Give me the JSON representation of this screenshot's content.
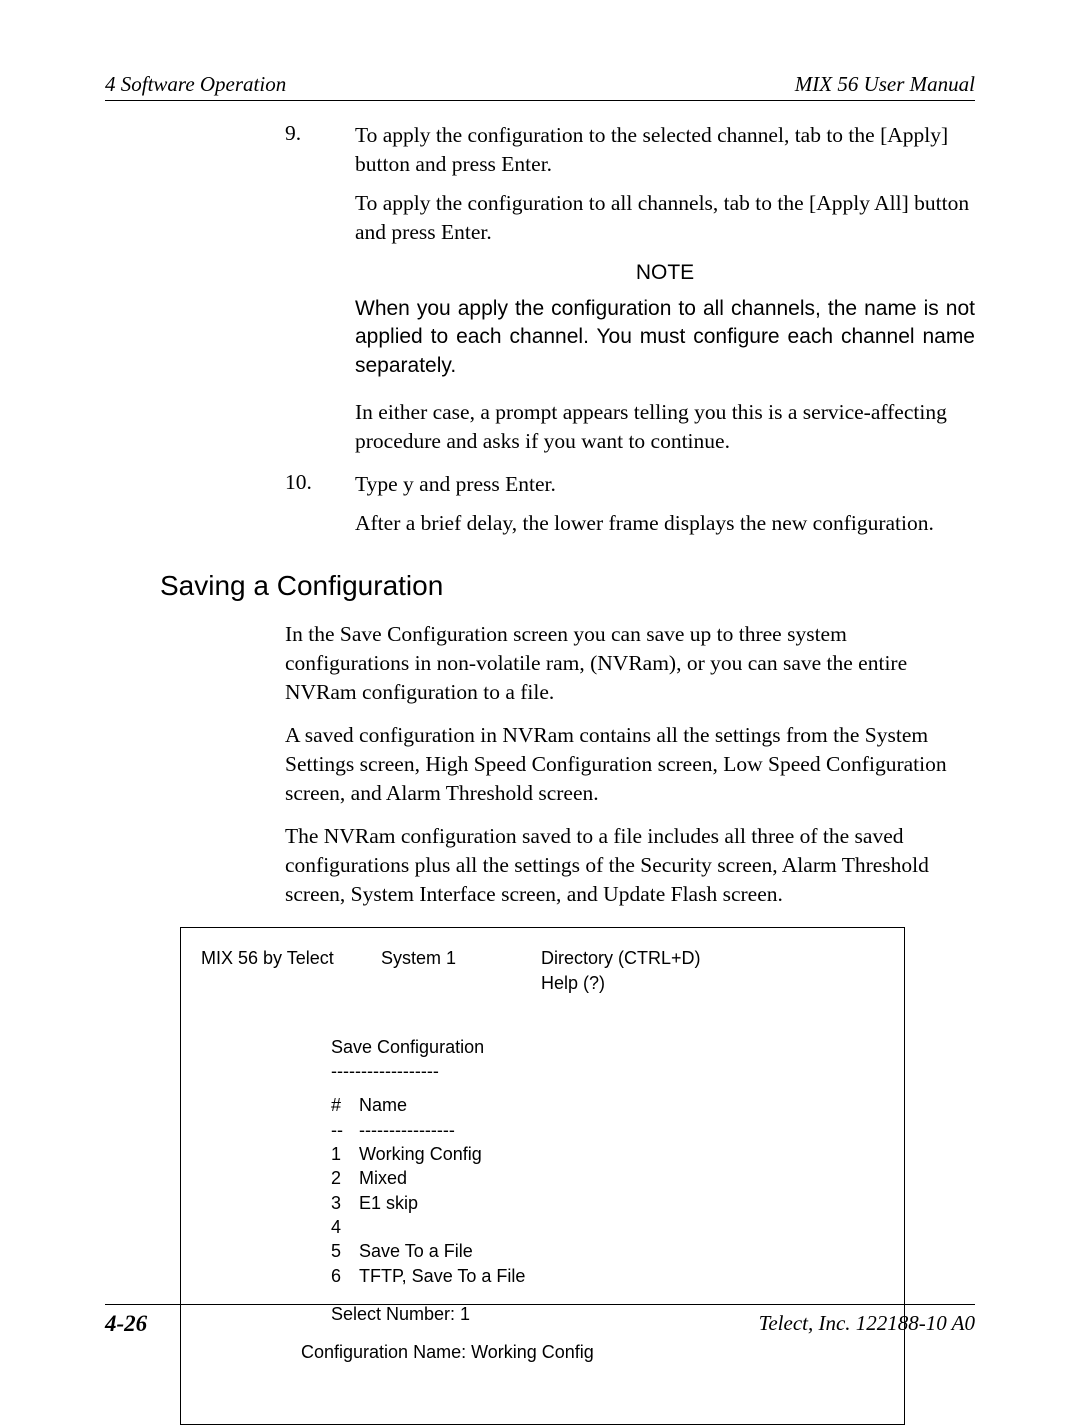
{
  "header": {
    "left": "4  Software Operation",
    "right": "MIX 56 User Manual"
  },
  "steps": {
    "s9num": "9.",
    "s9text": "To apply the configuration to the selected channel, tab to the [Apply] button and press Enter.",
    "s9follow": "To apply the configuration to all channels, tab to the [Apply All] button and press Enter.",
    "noteLabel": "NOTE",
    "noteBody": "When you apply the configuration to all channels, the name is not applied to each channel. You must configure each channel name separately.",
    "s9follow2": "In either case, a prompt appears telling you this is a service-affecting procedure and asks if you want to continue.",
    "s10num": "10.",
    "s10text": "Type y and press Enter.",
    "s10follow": "After a brief delay, the lower frame displays the new configuration."
  },
  "section": {
    "title": "Saving a Configuration",
    "p1": "In the Save Configuration screen you can save up to three system configurations in non-volatile ram, (NVRam), or you can save the entire NVRam configuration to a file.",
    "p2": "A saved configuration in NVRam contains all the settings from the System Settings screen, High Speed Configuration screen, Low Speed Configuration screen, and Alarm Threshold screen.",
    "p3": "The NVRam configuration saved to a file includes all three of the saved configurations plus all the settings of the Security screen, Alarm Threshold screen, System Interface screen, and Update Flash screen."
  },
  "terminal": {
    "brand": "MIX 56 by Telect",
    "system": "System 1",
    "dir": "Directory (CTRL+D)",
    "help": "Help (?)",
    "title": "Save Configuration",
    "underline1": "------------------",
    "colNum": "#",
    "colName": "Name",
    "underline2a": "--",
    "underline2b": "----------------",
    "rows": [
      {
        "n": "1",
        "name": "Working Config"
      },
      {
        "n": "2",
        "name": "Mixed"
      },
      {
        "n": "3",
        "name": "E1 skip"
      },
      {
        "n": "4",
        "name": ""
      },
      {
        "n": "5",
        "name": "Save To a File"
      },
      {
        "n": "6",
        "name": "TFTP, Save To a File"
      }
    ],
    "selectLabel": "Select Number: 1",
    "configName": "Configuration Name: Working Config"
  },
  "footer": {
    "page": "4-26",
    "right": "Telect, Inc.  122188-10 A0"
  }
}
